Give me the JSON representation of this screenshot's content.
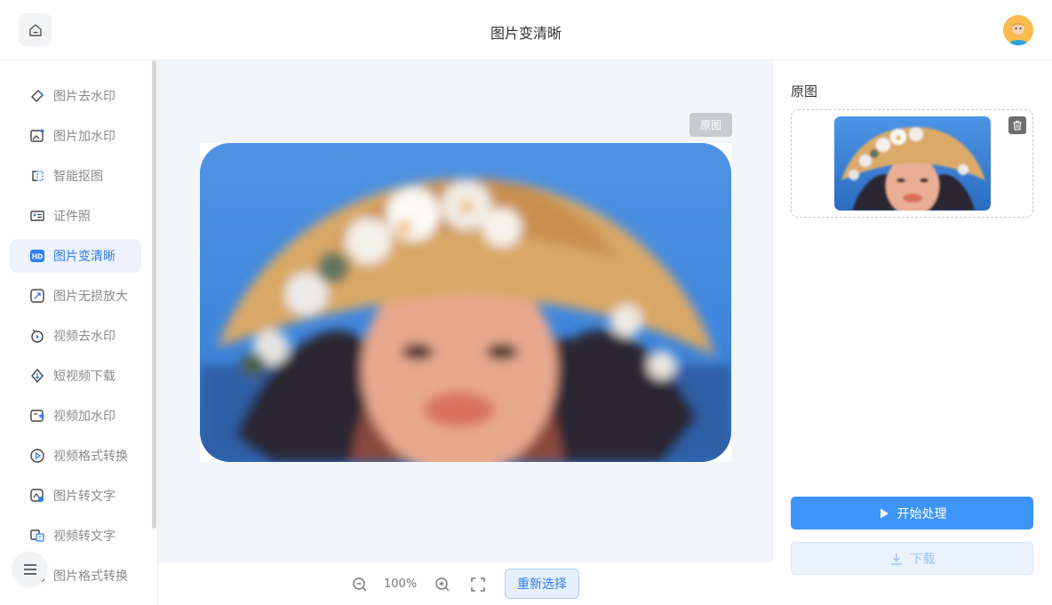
{
  "header": {
    "title": "图片变清晰",
    "home_icon": "home-icon",
    "avatar_icon": "user-avatar"
  },
  "sidebar": {
    "items": [
      {
        "label": "图片去水印",
        "icon": "eraser-icon",
        "active": false
      },
      {
        "label": "图片加水印",
        "icon": "image-add-icon",
        "active": false
      },
      {
        "label": "智能抠图",
        "icon": "cutout-icon",
        "active": false
      },
      {
        "label": "证件照",
        "icon": "id-card-icon",
        "active": false
      },
      {
        "label": "图片变清晰",
        "icon": "hd-icon",
        "active": true
      },
      {
        "label": "图片无损放大",
        "icon": "enlarge-icon",
        "active": false
      },
      {
        "label": "视频去水印",
        "icon": "video-clean-icon",
        "active": false
      },
      {
        "label": "短视频下载",
        "icon": "short-video-icon",
        "active": false
      },
      {
        "label": "视频加水印",
        "icon": "video-add-icon",
        "active": false
      },
      {
        "label": "视频格式转换",
        "icon": "video-convert-icon",
        "active": false
      },
      {
        "label": "图片转文字",
        "icon": "image-text-icon",
        "active": false
      },
      {
        "label": "视频转文字",
        "icon": "video-text-icon",
        "active": false
      },
      {
        "label": "图片格式转换",
        "icon": "image-convert-icon",
        "active": false
      }
    ],
    "menu_icon": "hamburger-menu-icon"
  },
  "canvas": {
    "tag_label": "原图"
  },
  "toolbar": {
    "zoom_value": "100%",
    "reselect_label": "重新选择"
  },
  "right_panel": {
    "original_label": "原图",
    "start_label": "开始处理",
    "download_label": "下载"
  },
  "colors": {
    "accent": "#3d95f9",
    "active_text": "#2b7ff2",
    "canvas_bg": "#f2f5fa"
  }
}
